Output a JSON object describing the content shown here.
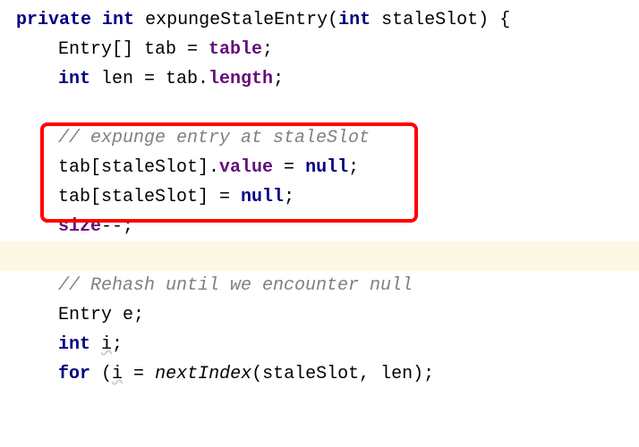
{
  "lines": {
    "l0": {
      "kw_private": "private",
      "kw_int": "int",
      "method": "expungeStaleEntry",
      "paren_open": "(",
      "kw_int2": "int",
      "param": " staleSlot",
      "paren_close": ")",
      "brace": " {"
    },
    "l1": {
      "t1": "Entry[] tab = ",
      "field": "table",
      "t2": ";"
    },
    "l2": {
      "kw_int": "int",
      "t1": " len = tab.",
      "field": "length",
      "t2": ";"
    },
    "l3": {
      "blank": " "
    },
    "l4": {
      "comment": "// expunge entry at staleSlot"
    },
    "l5": {
      "t1": "tab[staleSlot].",
      "field": "value",
      "t2": " = ",
      "kw_null": "null",
      "t3": ";"
    },
    "l6": {
      "t1": "tab[staleSlot] = ",
      "kw_null": "null",
      "t2": ";"
    },
    "l7": {
      "field": "size",
      "t1": "--;"
    },
    "l8": {
      "blank": " "
    },
    "l9": {
      "comment": "// Rehash until we encounter null"
    },
    "l10": {
      "t1": "Entry e;"
    },
    "l11": {
      "kw_int": "int",
      "sp": " ",
      "var": "i",
      "t1": ";"
    },
    "l12": {
      "kw_for": "for",
      "t1": " (",
      "var": "i",
      "t2": " = ",
      "fn": "nextIndex",
      "t3": "(staleSlot, len);"
    }
  }
}
